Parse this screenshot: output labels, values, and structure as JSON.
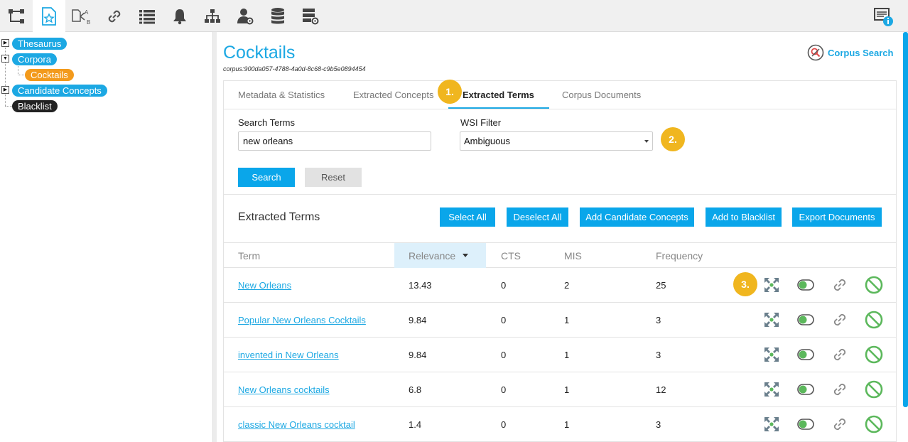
{
  "toolbar": {
    "icons": [
      "hierarchy-icon",
      "document-star-icon",
      "document-ab-icon",
      "link-icon",
      "list-icon",
      "bell-icon",
      "org-chart-icon",
      "user-settings-icon",
      "database-icon",
      "server-settings-icon"
    ],
    "active_index": 1,
    "info_icon": "info-panel-icon"
  },
  "tree": {
    "items": [
      {
        "label": "Thesaurus",
        "color": "blue",
        "expandable": true
      },
      {
        "label": "Corpora",
        "color": "blue",
        "expandable": true,
        "expanded": true
      },
      {
        "label": "Cocktails",
        "color": "orange",
        "child": true
      },
      {
        "label": "Candidate Concepts",
        "color": "blue",
        "expandable": true
      },
      {
        "label": "Blacklist",
        "color": "black"
      }
    ]
  },
  "main": {
    "title": "Cocktails",
    "corpus_id": "corpus:900da057-4788-4a0d-8c68-c9b5e0894454",
    "corpus_search_label": "Corpus Search",
    "tabs": [
      "Metadata & Statistics",
      "Extracted Concepts",
      "Extracted Terms",
      "Corpus Documents"
    ],
    "active_tab": "Extracted Terms",
    "badges": [
      "1.",
      "2.",
      "3."
    ],
    "search": {
      "label": "Search Terms",
      "value": "new orleans",
      "wsi_label": "WSI Filter",
      "wsi_value": "Ambiguous",
      "search_button": "Search",
      "reset_button": "Reset"
    },
    "section_title": "Extracted Terms",
    "actions": [
      "Select All",
      "Deselect All",
      "Add Candidate Concepts",
      "Add to Blacklist",
      "Export Documents"
    ],
    "columns": [
      "Term",
      "Relevance",
      "CTS",
      "MIS",
      "Frequency"
    ],
    "rows": [
      {
        "term": "New Orleans",
        "relevance": "13.43",
        "cts": "0",
        "mis": "2",
        "frequency": "25"
      },
      {
        "term": "Popular New Orleans Cocktails",
        "relevance": "9.84",
        "cts": "0",
        "mis": "1",
        "frequency": "3"
      },
      {
        "term": "invented in New Orleans",
        "relevance": "9.84",
        "cts": "0",
        "mis": "1",
        "frequency": "3"
      },
      {
        "term": "New Orleans cocktails",
        "relevance": "6.8",
        "cts": "0",
        "mis": "1",
        "frequency": "12"
      },
      {
        "term": "classic New Orleans cocktail",
        "relevance": "1.4",
        "cts": "0",
        "mis": "1",
        "frequency": "3"
      }
    ],
    "row_icons": [
      "expand-arrows-icon",
      "toggle-icon",
      "link-icon",
      "block-icon"
    ],
    "colors": {
      "accent": "#1ca8e3",
      "badge": "#f0b61f",
      "green": "#5cb85c",
      "orange": "#f39a1c"
    }
  }
}
